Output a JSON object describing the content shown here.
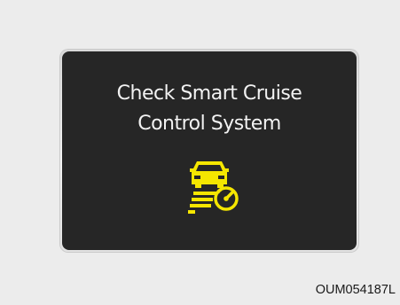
{
  "display": {
    "message_line_1": "Check Smart Cruise",
    "message_line_2": "Control System",
    "icon": "smart-cruise-control-warning-icon",
    "text_color": "#f2f2f2",
    "icon_color": "#f5e600",
    "background_color": "#262626"
  },
  "image_code": "OUM054187L"
}
